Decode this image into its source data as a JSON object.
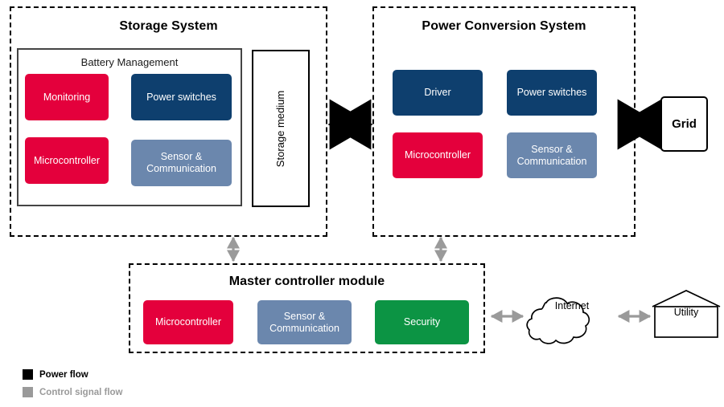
{
  "diagram": {
    "title_storage": "Storage System",
    "title_pcs": "Power Conversion System",
    "title_master": "Master controller module",
    "panel_battery": "Battery Management"
  },
  "colors": {
    "red": "#E4003C",
    "dark_blue": "#0E3F6E",
    "steel_blue": "#6B87AD",
    "green": "#0C9444",
    "power_flow": "#000000",
    "control_flow": "#9A9A9A"
  },
  "storage_system": {
    "blocks": [
      {
        "label": "Monitoring",
        "color": "#E4003C"
      },
      {
        "label": "Power switches",
        "color": "#0E3F6E"
      },
      {
        "label": "Microcontroller",
        "color": "#E4003C"
      },
      {
        "label": "Sensor &\nCommunication",
        "color": "#6B87AD"
      }
    ],
    "storage_medium_label": "Storage medium"
  },
  "power_conversion_system": {
    "blocks": [
      {
        "label": "Driver",
        "color": "#0E3F6E"
      },
      {
        "label": "Power switches",
        "color": "#0E3F6E"
      },
      {
        "label": "Microcontroller",
        "color": "#E4003C"
      },
      {
        "label": "Sensor &\nCommunication",
        "color": "#6B87AD"
      }
    ]
  },
  "master_controller": {
    "blocks": [
      {
        "label": "Microcontroller",
        "color": "#E4003C"
      },
      {
        "label": "Sensor &\nCommunication",
        "color": "#6B87AD"
      },
      {
        "label": "Security",
        "color": "#0C9444"
      }
    ]
  },
  "external": {
    "grid_label": "Grid",
    "internet_label": "Internet",
    "utility_label": "Utility"
  },
  "legend": [
    {
      "label": "Power flow",
      "color": "#000000"
    },
    {
      "label": "Control signal flow",
      "color": "#9A9A9A"
    }
  ]
}
